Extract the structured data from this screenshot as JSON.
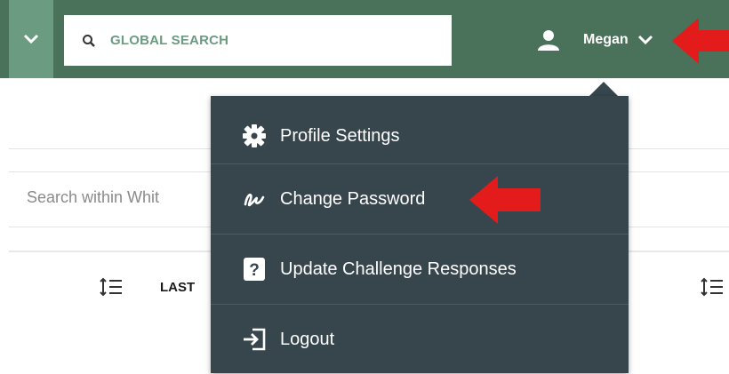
{
  "topbar": {
    "search_placeholder": "GLOBAL SEARCH",
    "user_name": "Megan",
    "colors": {
      "bar": "#4a715a",
      "collapse": "#6b9b80",
      "accent_text": "#6b9b80"
    }
  },
  "page": {
    "search_placeholder": "Search within Whit",
    "column_label": "LAST"
  },
  "user_menu": {
    "items": [
      {
        "label": "Profile Settings",
        "icon": "gear-icon"
      },
      {
        "label": "Change Password",
        "icon": "signature-icon"
      },
      {
        "label": "Update Challenge Responses",
        "icon": "question-box-icon"
      },
      {
        "label": "Logout",
        "icon": "sign-out-icon"
      }
    ],
    "background": "#37464d"
  },
  "annotations": {
    "arrow_color": "#e31b1b"
  }
}
